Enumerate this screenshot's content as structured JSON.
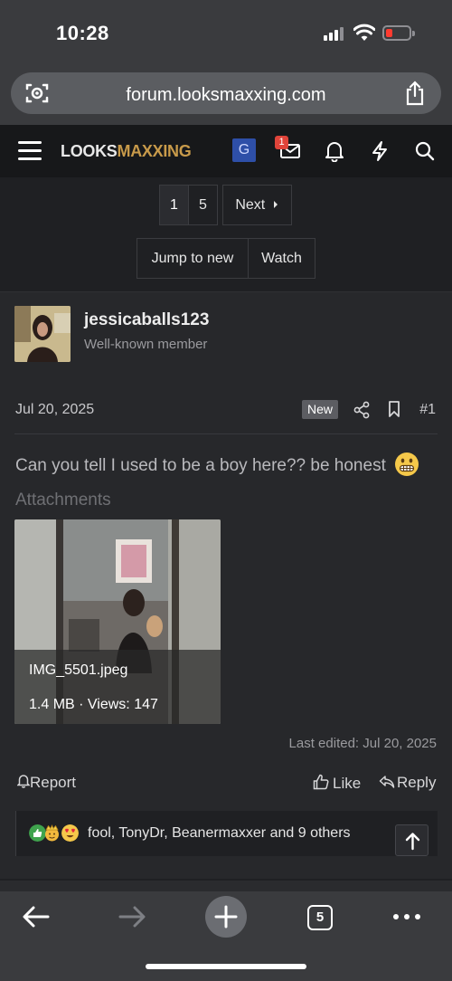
{
  "status_bar": {
    "time": "10:28"
  },
  "browser": {
    "url": "forum.looksmaxxing.com",
    "tab_count": "5"
  },
  "site_header": {
    "logo_part1": "LOOKS",
    "logo_part2": "MAXXING",
    "profile_badge": "G",
    "inbox_count": "1",
    "colors": {
      "header_bg": "#17181a",
      "logo_accent": "#c89a4a",
      "badge_bg": "#2e4fa8",
      "alert_red": "#e0443a"
    }
  },
  "pagination": {
    "pages": [
      "1",
      "5"
    ],
    "current": "1",
    "next_label": "Next",
    "jump_label": "Jump to new",
    "watch_label": "Watch"
  },
  "post": {
    "username": "jessicaballs123",
    "user_title": "Well-known member",
    "date": "Jul 20, 2025",
    "new_badge": "New",
    "post_number": "#1",
    "message": "Can you tell I used to be a boy here?? be honest",
    "attachments_label": "Attachments",
    "attachment": {
      "filename": "IMG_5501.jpeg",
      "meta": "1.4 MB · Views: 147"
    },
    "last_edited": "Last edited: Jul 20, 2025",
    "actions": {
      "report": "Report",
      "like": "Like",
      "reply": "Reply"
    },
    "reactions_text": "fool, TonyDr, Beanermaxxer and 9 others"
  }
}
